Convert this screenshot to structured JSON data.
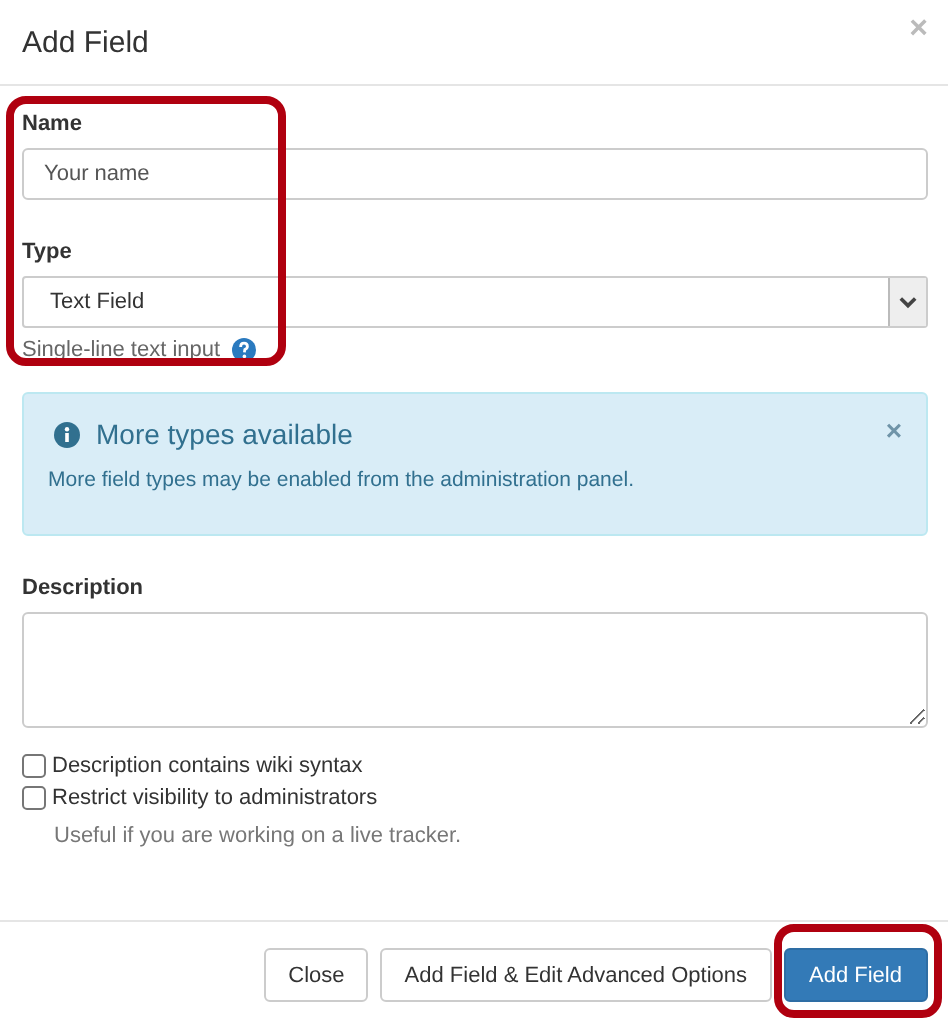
{
  "dialog": {
    "title": "Add Field",
    "close_icon": "×"
  },
  "name_field": {
    "label": "Name",
    "placeholder": "Your name"
  },
  "type_field": {
    "label": "Type",
    "value": "Text Field",
    "help": "Single-line text input"
  },
  "alert": {
    "title": "More types available",
    "message": "More field types may be enabled from the administration panel.",
    "close": "×"
  },
  "description_field": {
    "label": "Description"
  },
  "checkboxes": [
    {
      "label": "Description contains wiki syntax",
      "checked": false
    },
    {
      "label": "Restrict visibility to administrators",
      "checked": false,
      "hint": "Useful if you are working on a live tracker."
    }
  ],
  "buttons": [
    {
      "label": "Close",
      "kind": "default"
    },
    {
      "label": "Add Field & Edit Advanced Options",
      "kind": "default"
    },
    {
      "label": "Add Field",
      "kind": "primary"
    }
  ]
}
